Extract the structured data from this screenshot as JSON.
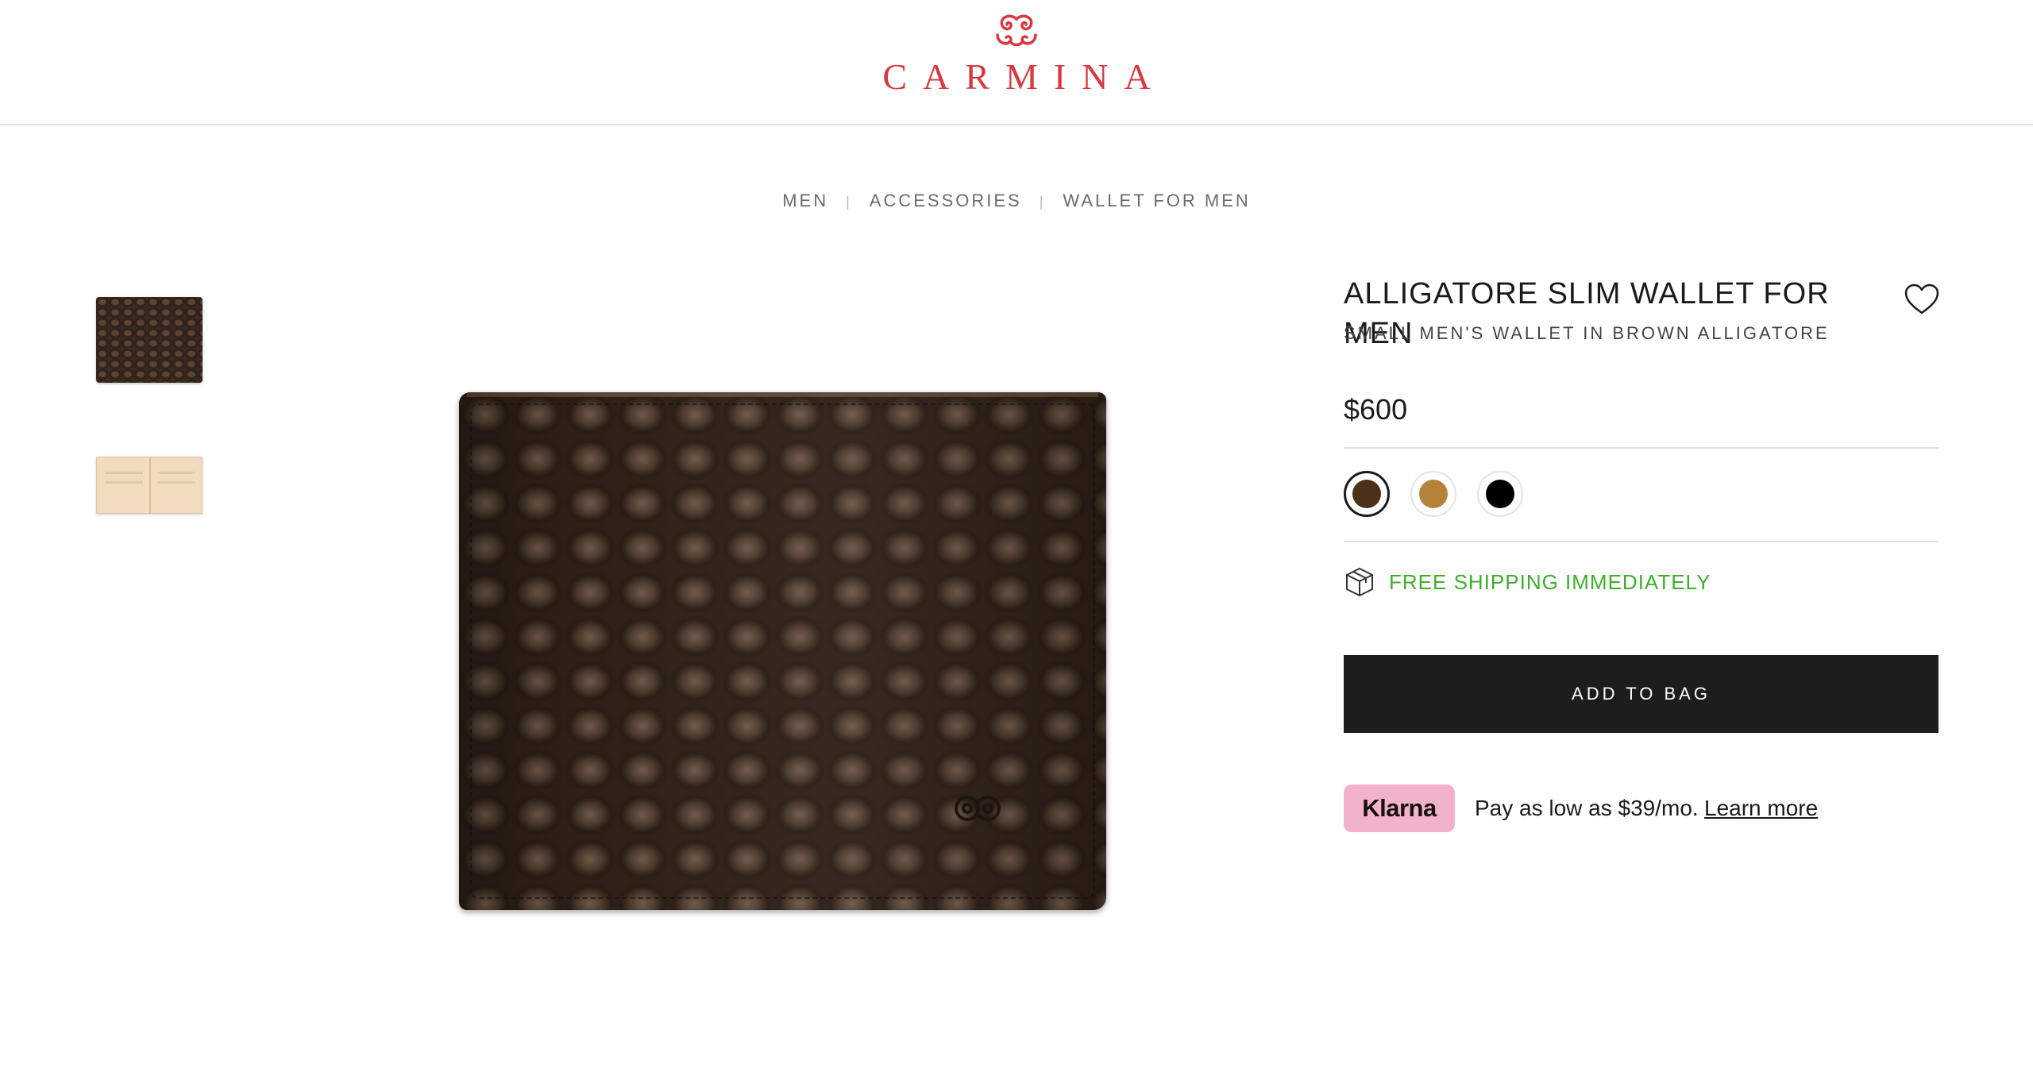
{
  "brand": {
    "name": "CARMINA",
    "color": "#d8383e"
  },
  "breadcrumb": [
    {
      "label": "MEN"
    },
    {
      "label": "ACCESSORIES"
    },
    {
      "label": "WALLET FOR MEN"
    }
  ],
  "gallery": {
    "thumbnails": [
      {
        "name": "brown-alligator-wallet-closed",
        "selected": true
      },
      {
        "name": "wallet-open-interior",
        "selected": false
      }
    ]
  },
  "product": {
    "title": "ALLIGATORE SLIM WALLET FOR MEN",
    "subtitle": "SMALL MEN'S WALLET IN BROWN ALLIGATORE",
    "price": "$600",
    "wishlist_icon": "heart-icon"
  },
  "swatches": [
    {
      "color": "#4a3118",
      "selected": true
    },
    {
      "color": "#b5823a",
      "selected": false
    },
    {
      "color": "#000000",
      "selected": false
    }
  ],
  "shipping": {
    "icon": "box-icon",
    "text": "FREE SHIPPING IMMEDIATELY",
    "color": "#3fae2a"
  },
  "cart": {
    "add_label": "ADD TO BAG"
  },
  "klarna": {
    "badge": "Klarna",
    "text": "Pay as low as $39/mo.",
    "link": "Learn more",
    "badge_color": "#f3b2cc"
  }
}
